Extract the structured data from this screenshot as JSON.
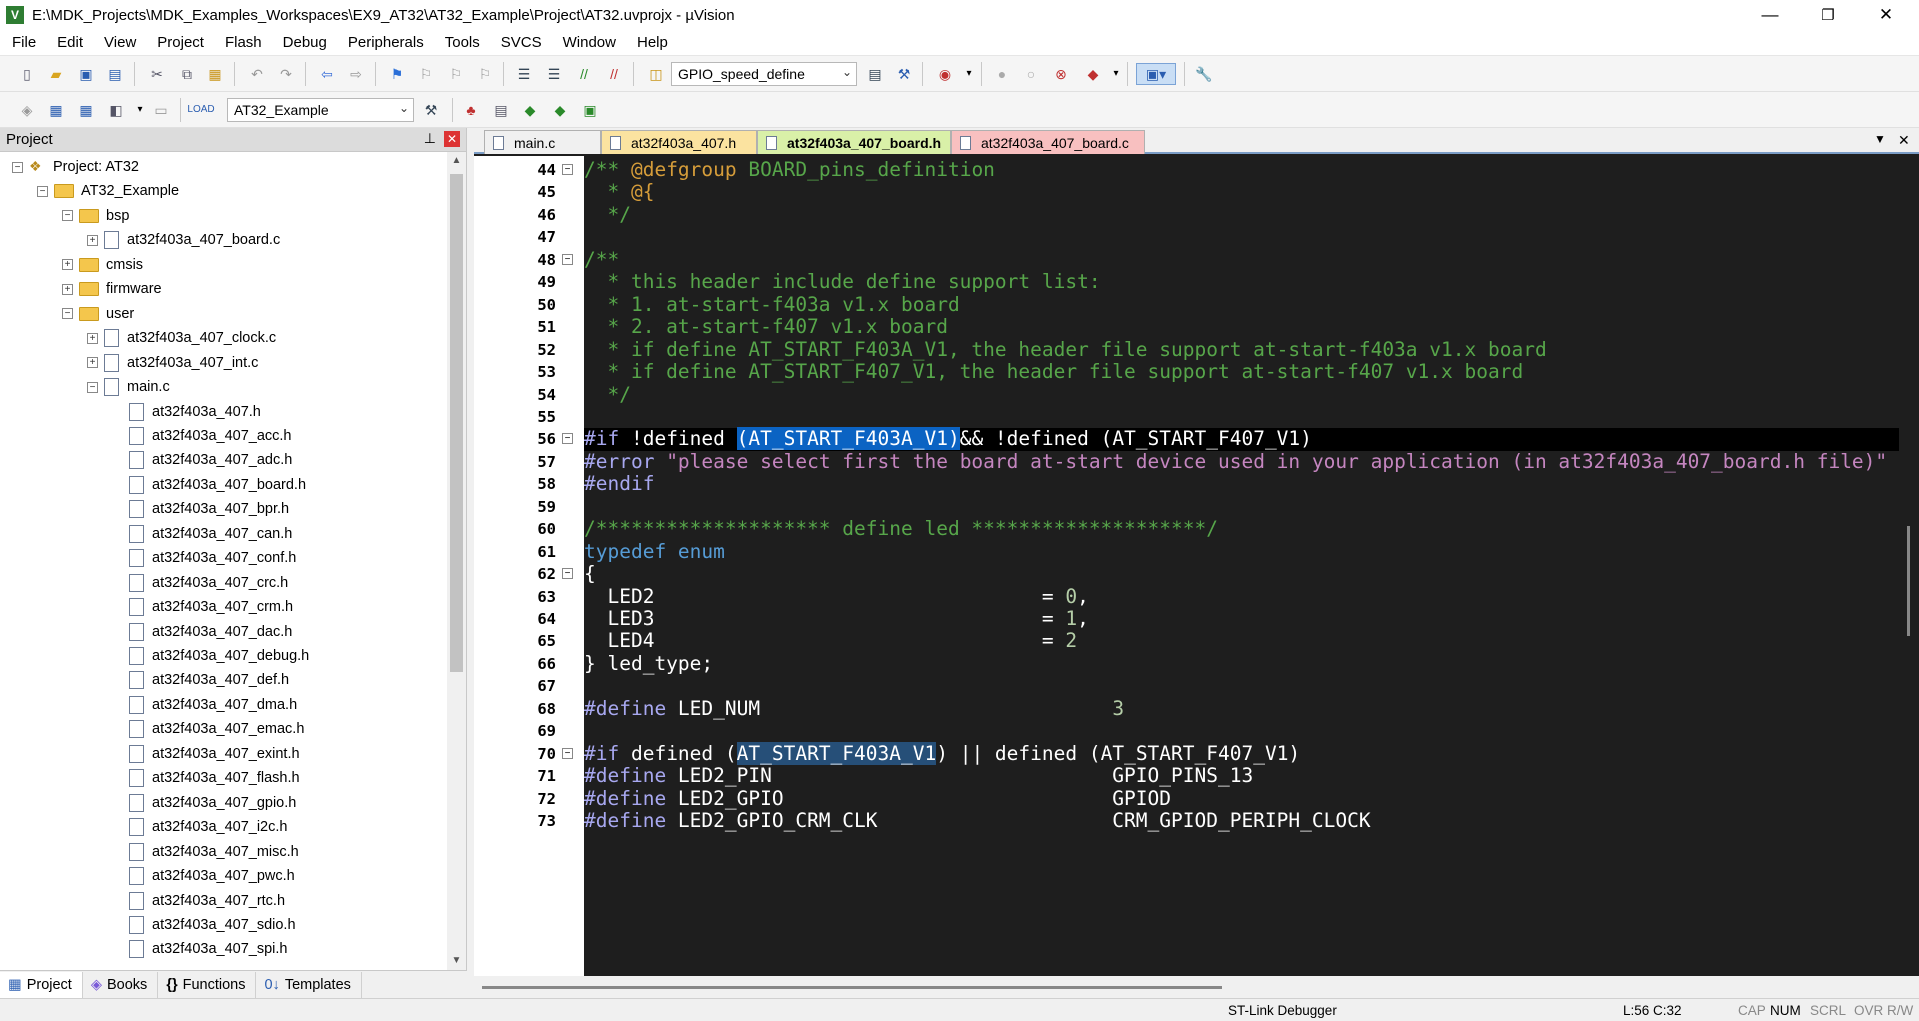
{
  "window": {
    "title": "E:\\MDK_Projects\\MDK_Examples_Workspaces\\EX9_AT32\\AT32_Example\\Project\\AT32.uvprojx - µVision",
    "app_icon": "V",
    "minimize": "—",
    "maximize": "❐",
    "close": "✕"
  },
  "menu": [
    "File",
    "Edit",
    "View",
    "Project",
    "Flash",
    "Debug",
    "Peripherals",
    "Tools",
    "SVCS",
    "Window",
    "Help"
  ],
  "toolbar": {
    "define_combo": "GPIO_speed_define",
    "target_combo": "AT32_Example"
  },
  "project": {
    "header": "Project",
    "pin": "♠",
    "close": "✕",
    "tree": [
      {
        "label": "Project: AT32",
        "level": 0,
        "kind": "project",
        "exp": "−"
      },
      {
        "label": "AT32_Example",
        "level": 1,
        "kind": "folder",
        "exp": "−"
      },
      {
        "label": "bsp",
        "level": 2,
        "kind": "folder",
        "exp": "−"
      },
      {
        "label": "at32f403a_407_board.c",
        "level": 3,
        "kind": "file",
        "exp": "+"
      },
      {
        "label": "cmsis",
        "level": 2,
        "kind": "folder",
        "exp": "+"
      },
      {
        "label": "firmware",
        "level": 2,
        "kind": "folder",
        "exp": "+"
      },
      {
        "label": "user",
        "level": 2,
        "kind": "folder",
        "exp": "−"
      },
      {
        "label": "at32f403a_407_clock.c",
        "level": 3,
        "kind": "file",
        "exp": "+"
      },
      {
        "label": "at32f403a_407_int.c",
        "level": 3,
        "kind": "file",
        "exp": "+"
      },
      {
        "label": "main.c",
        "level": 3,
        "kind": "file",
        "exp": "−"
      },
      {
        "label": "at32f403a_407.h",
        "level": 4,
        "kind": "file",
        "exp": ""
      },
      {
        "label": "at32f403a_407_acc.h",
        "level": 4,
        "kind": "file",
        "exp": ""
      },
      {
        "label": "at32f403a_407_adc.h",
        "level": 4,
        "kind": "file",
        "exp": ""
      },
      {
        "label": "at32f403a_407_board.h",
        "level": 4,
        "kind": "file",
        "exp": ""
      },
      {
        "label": "at32f403a_407_bpr.h",
        "level": 4,
        "kind": "file",
        "exp": ""
      },
      {
        "label": "at32f403a_407_can.h",
        "level": 4,
        "kind": "file",
        "exp": ""
      },
      {
        "label": "at32f403a_407_conf.h",
        "level": 4,
        "kind": "file",
        "exp": ""
      },
      {
        "label": "at32f403a_407_crc.h",
        "level": 4,
        "kind": "file",
        "exp": ""
      },
      {
        "label": "at32f403a_407_crm.h",
        "level": 4,
        "kind": "file",
        "exp": ""
      },
      {
        "label": "at32f403a_407_dac.h",
        "level": 4,
        "kind": "file",
        "exp": ""
      },
      {
        "label": "at32f403a_407_debug.h",
        "level": 4,
        "kind": "file",
        "exp": ""
      },
      {
        "label": "at32f403a_407_def.h",
        "level": 4,
        "kind": "file",
        "exp": ""
      },
      {
        "label": "at32f403a_407_dma.h",
        "level": 4,
        "kind": "file",
        "exp": ""
      },
      {
        "label": "at32f403a_407_emac.h",
        "level": 4,
        "kind": "file",
        "exp": ""
      },
      {
        "label": "at32f403a_407_exint.h",
        "level": 4,
        "kind": "file",
        "exp": ""
      },
      {
        "label": "at32f403a_407_flash.h",
        "level": 4,
        "kind": "file",
        "exp": ""
      },
      {
        "label": "at32f403a_407_gpio.h",
        "level": 4,
        "kind": "file",
        "exp": ""
      },
      {
        "label": "at32f403a_407_i2c.h",
        "level": 4,
        "kind": "file",
        "exp": ""
      },
      {
        "label": "at32f403a_407_misc.h",
        "level": 4,
        "kind": "file",
        "exp": ""
      },
      {
        "label": "at32f403a_407_pwc.h",
        "level": 4,
        "kind": "file",
        "exp": ""
      },
      {
        "label": "at32f403a_407_rtc.h",
        "level": 4,
        "kind": "file",
        "exp": ""
      },
      {
        "label": "at32f403a_407_sdio.h",
        "level": 4,
        "kind": "file",
        "exp": ""
      },
      {
        "label": "at32f403a_407_spi.h",
        "level": 4,
        "kind": "file",
        "exp": ""
      }
    ],
    "bottom_tabs": [
      {
        "label": "Project",
        "icon": "▦",
        "active": true
      },
      {
        "label": "Books",
        "icon": "◈",
        "active": false
      },
      {
        "label": "Functions",
        "icon": "{}",
        "active": false
      },
      {
        "label": "Templates",
        "icon": "0↓",
        "active": false
      }
    ]
  },
  "editor": {
    "tabs": [
      {
        "label": "main.c",
        "bg": "#f0f0f0",
        "active": false
      },
      {
        "label": "at32f403a_407.h",
        "bg": "#fbe3a0",
        "active": false
      },
      {
        "label": "at32f403a_407_board.h",
        "bg": "#d9f0a8",
        "active": true
      },
      {
        "label": "at32f403a_407_board.c",
        "bg": "#f8c0c0",
        "active": false
      }
    ],
    "tab_menu": "▼",
    "tab_close": "✕",
    "lines": [
      {
        "n": "44",
        "fold": "−",
        "seg": [
          [
            "cm",
            "/** "
          ],
          [
            "tag",
            "@defgroup"
          ],
          [
            "cm",
            " BOARD_pins_definition"
          ]
        ]
      },
      {
        "n": "45",
        "seg": [
          [
            "cm",
            "  * "
          ],
          [
            "tag",
            "@{"
          ]
        ]
      },
      {
        "n": "46",
        "seg": [
          [
            "cm",
            "  */"
          ]
        ]
      },
      {
        "n": "47",
        "seg": []
      },
      {
        "n": "48",
        "fold": "−",
        "seg": [
          [
            "cm",
            "/**"
          ]
        ]
      },
      {
        "n": "49",
        "seg": [
          [
            "cm",
            "  * this header include define support list:"
          ]
        ]
      },
      {
        "n": "50",
        "seg": [
          [
            "cm",
            "  * 1. at-start-f403a v1.x board"
          ]
        ]
      },
      {
        "n": "51",
        "seg": [
          [
            "cm",
            "  * 2. at-start-f407 v1.x board"
          ]
        ]
      },
      {
        "n": "52",
        "seg": [
          [
            "cm",
            "  * if define AT_START_F403A_V1, the header file support at-start-f403a v1.x board"
          ]
        ]
      },
      {
        "n": "53",
        "seg": [
          [
            "cm",
            "  * if define AT_START_F407_V1, the header file support at-start-f407 v1.x board"
          ]
        ]
      },
      {
        "n": "54",
        "seg": [
          [
            "cm",
            "  */"
          ]
        ]
      },
      {
        "n": "55",
        "seg": []
      },
      {
        "n": "56",
        "fold": "−",
        "hl": true,
        "seg": [
          [
            "pp",
            "#if"
          ],
          [
            "pl",
            " !defined "
          ],
          [
            "selstrong",
            "(AT_START_F403A_V1)"
          ],
          [
            "pl",
            "&& !defined (AT_START_F407_V1)"
          ]
        ]
      },
      {
        "n": "57",
        "seg": [
          [
            "pp",
            "#error"
          ],
          [
            "str",
            " \"please select first the board at-start device used in your application (in at32f403a_407_board.h file)\""
          ]
        ]
      },
      {
        "n": "58",
        "seg": [
          [
            "pp",
            "#endif"
          ]
        ]
      },
      {
        "n": "59",
        "seg": []
      },
      {
        "n": "60",
        "seg": [
          [
            "cm",
            "/******************** define led ********************/"
          ]
        ]
      },
      {
        "n": "61",
        "seg": [
          [
            "kw",
            "typedef enum"
          ]
        ]
      },
      {
        "n": "62",
        "fold": "−",
        "seg": [
          [
            "pl",
            "{"
          ]
        ]
      },
      {
        "n": "63",
        "seg": [
          [
            "pl",
            "  LED2                                 = "
          ],
          [
            "num",
            "0"
          ],
          [
            "pl",
            ","
          ]
        ]
      },
      {
        "n": "64",
        "seg": [
          [
            "pl",
            "  LED3                                 = "
          ],
          [
            "num",
            "1"
          ],
          [
            "pl",
            ","
          ]
        ]
      },
      {
        "n": "65",
        "seg": [
          [
            "pl",
            "  LED4                                 = "
          ],
          [
            "num",
            "2"
          ]
        ]
      },
      {
        "n": "66",
        "seg": [
          [
            "pl",
            "} led_type;"
          ]
        ]
      },
      {
        "n": "67",
        "seg": []
      },
      {
        "n": "68",
        "seg": [
          [
            "pp",
            "#define"
          ],
          [
            "pl",
            " LED_NUM                              "
          ],
          [
            "num",
            "3"
          ]
        ]
      },
      {
        "n": "69",
        "seg": []
      },
      {
        "n": "70",
        "fold": "−",
        "seg": [
          [
            "pp",
            "#if"
          ],
          [
            "pl",
            " defined ("
          ],
          [
            "sel",
            "AT_START_F403A_V1"
          ],
          [
            "pl",
            ") || defined (AT_START_F407_V1)"
          ]
        ]
      },
      {
        "n": "71",
        "seg": [
          [
            "pp",
            "#define"
          ],
          [
            "pl",
            " LED2_PIN                             GPIO_PINS_13"
          ]
        ]
      },
      {
        "n": "72",
        "seg": [
          [
            "pp",
            "#define"
          ],
          [
            "pl",
            " LED2_GPIO                            GPIOD"
          ]
        ]
      },
      {
        "n": "73",
        "seg": [
          [
            "pp",
            "#define"
          ],
          [
            "pl",
            " LED2_GPIO_CRM_CLK                    CRM_GPIOD_PERIPH_CLOCK"
          ]
        ]
      }
    ]
  },
  "status": {
    "debugger": "ST-Link Debugger",
    "position": "L:56 C:32",
    "caps": "CAP",
    "num": "NUM",
    "scrl": "SCRL",
    "ovr": "OVR",
    "rw": "R/W"
  }
}
